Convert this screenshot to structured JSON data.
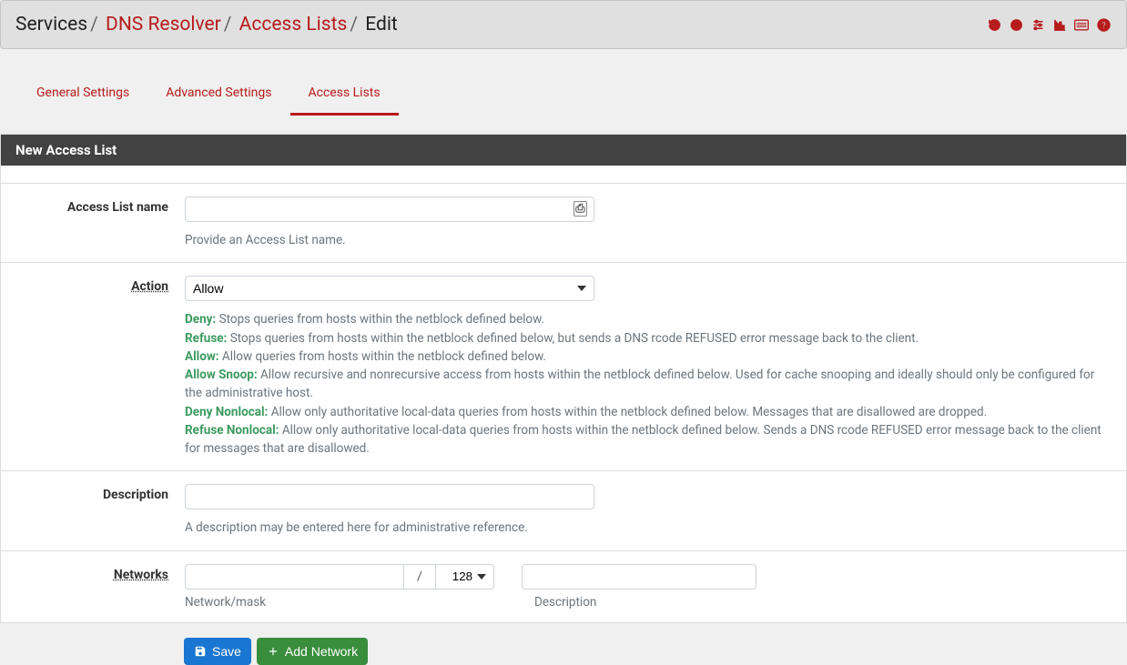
{
  "breadcrumb": {
    "root": "Services",
    "l1": "DNS Resolver",
    "l2": "Access Lists",
    "current": "Edit"
  },
  "tabs": {
    "general": "General Settings",
    "advanced": "Advanced Settings",
    "access": "Access Lists"
  },
  "panel": {
    "heading": "New Access List"
  },
  "form": {
    "name_label": "Access List name",
    "name_value": "",
    "name_help": "Provide an Access List name.",
    "action_label": "Action",
    "action_value": "Allow",
    "action_help": {
      "deny_k": "Deny:",
      "deny": "Stops queries from hosts within the netblock defined below.",
      "refuse_k": "Refuse:",
      "refuse": "Stops queries from hosts within the netblock defined below, but sends a DNS rcode REFUSED error message back to the client.",
      "allow_k": "Allow:",
      "allow": "Allow queries from hosts within the netblock defined below.",
      "snoop_k": "Allow Snoop:",
      "snoop": "Allow recursive and nonrecursive access from hosts within the netblock defined below. Used for cache snooping and ideally should only be configured for the administrative host.",
      "dnl_k": "Deny Nonlocal:",
      "dnl": "Allow only authoritative local-data queries from hosts within the netblock defined below. Messages that are disallowed are dropped.",
      "rnl_k": "Refuse Nonlocal:",
      "rnl": "Allow only authoritative local-data queries from hosts within the netblock defined below. Sends a DNS rcode REFUSED error message back to the client for messages that are disallowed."
    },
    "desc_label": "Description",
    "desc_value": "",
    "desc_help": "A description may be entered here for administrative reference.",
    "networks_label": "Networks",
    "network0": {
      "addr": "",
      "sep": "/",
      "mask": "128",
      "desc": ""
    },
    "sublabels": {
      "nm": "Network/mask",
      "desc": "Description"
    }
  },
  "buttons": {
    "save": "Save",
    "add_network": "Add Network"
  }
}
